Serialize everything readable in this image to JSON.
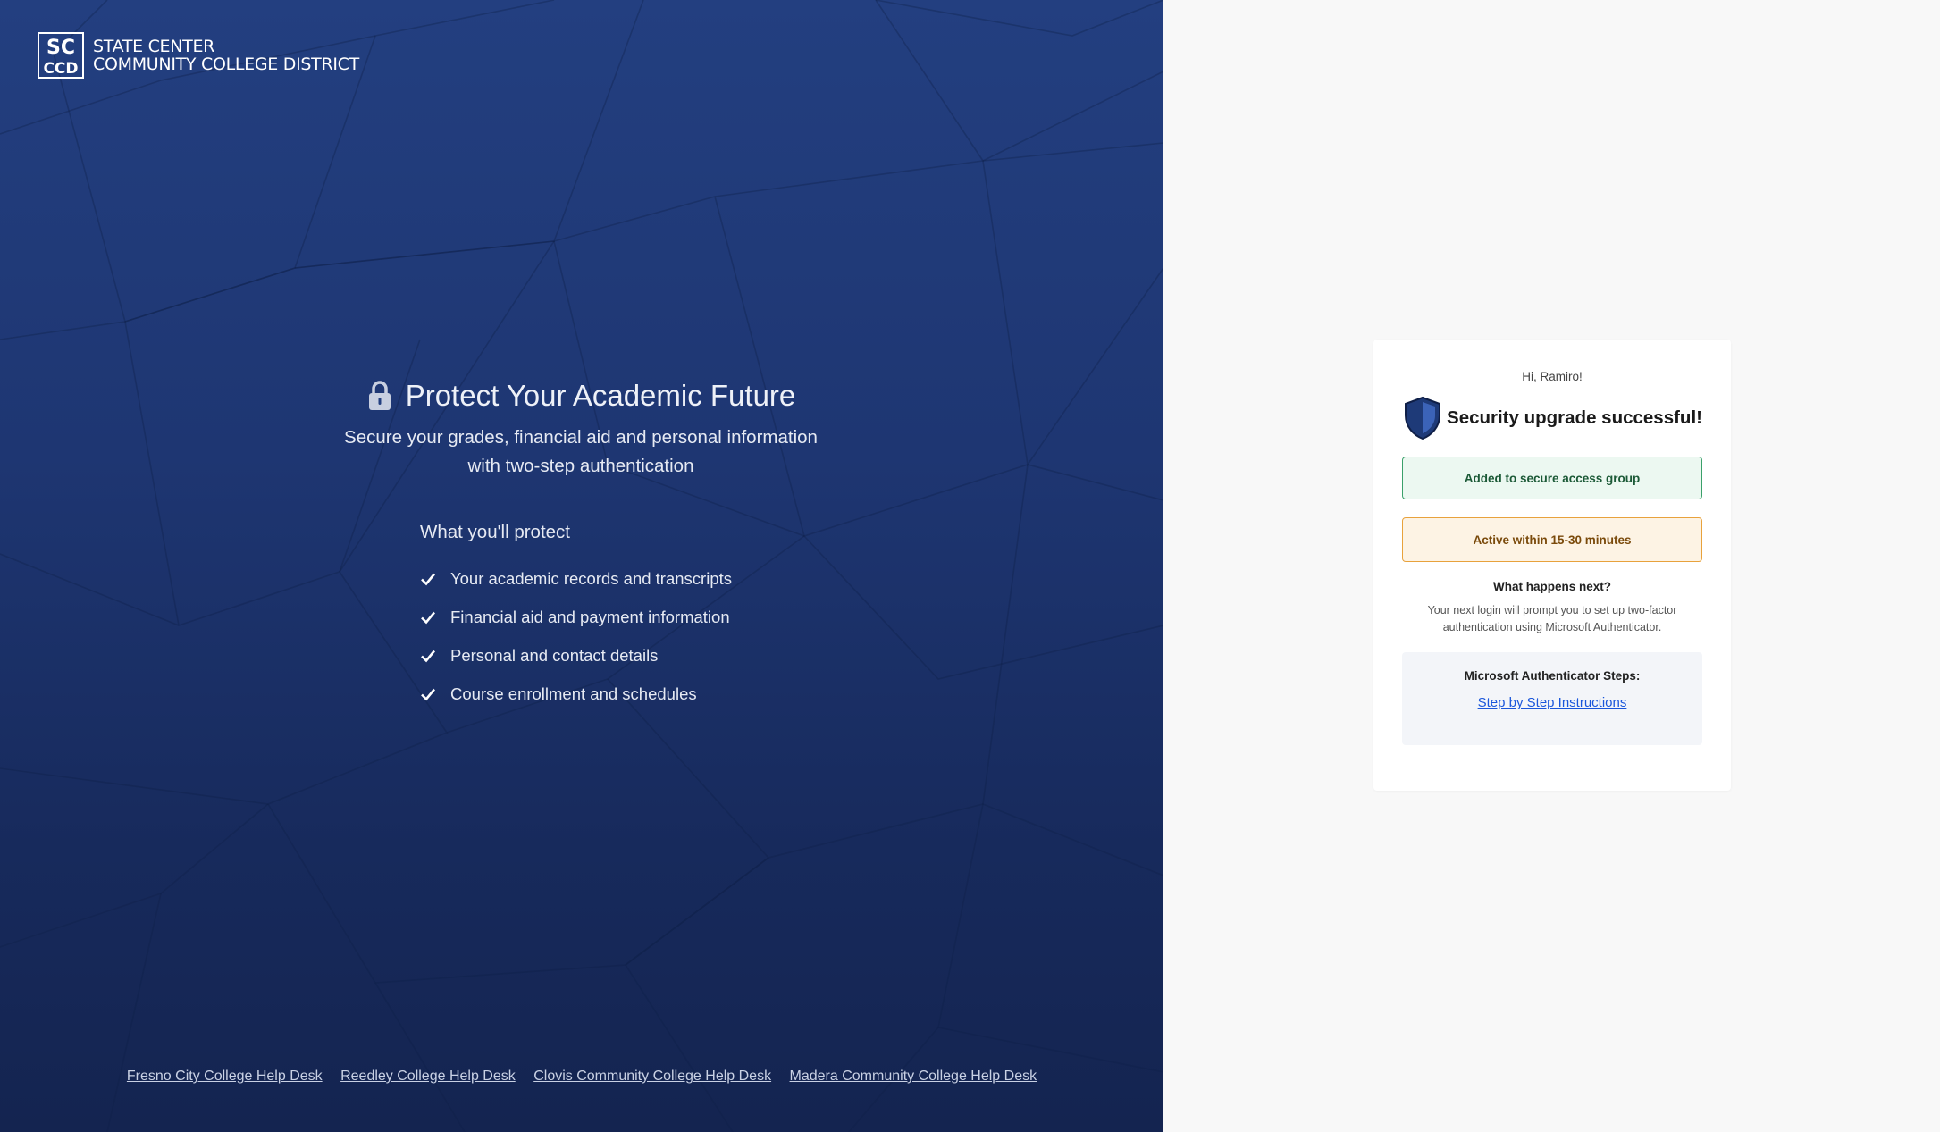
{
  "brand": {
    "logo_letters_top": "SC",
    "logo_letters_bottom": "CCD",
    "line1": "STATE CENTER",
    "line2": "COMMUNITY COLLEGE DISTRICT"
  },
  "hero": {
    "title": "Protect Your Academic Future",
    "subtitle_line1": "Secure your grades, financial aid and personal information",
    "subtitle_line2": "with two-step authentication",
    "icon": "lock-icon"
  },
  "protect": {
    "title": "What you'll protect",
    "items": [
      "Your academic records and transcripts",
      "Financial aid and payment information",
      "Personal and contact details",
      "Course enrollment and schedules"
    ]
  },
  "footer": {
    "links": [
      "Fresno City College Help Desk",
      "Reedley College Help Desk",
      "Clovis Community College Help Desk",
      "Madera Community College Help Desk"
    ]
  },
  "card": {
    "greeting": "Hi, Ramiro!",
    "title": "Security upgrade successful!",
    "status_group": "Added to secure access group",
    "status_time": "Active within 15-30 minutes",
    "next_title": "What happens next?",
    "next_text_line1": "Your next login will prompt you to set up two-factor",
    "next_text_line2": "authentication using Microsoft Authenticator.",
    "steps_title": "Microsoft Authenticator Steps:",
    "steps_link": "Step by Step Instructions"
  },
  "colors": {
    "panel_top": "#233f80",
    "panel_bottom": "#142450",
    "success_bg": "#ecf8f1",
    "success_border": "#3aa06a",
    "warning_bg": "#fdf3e4",
    "warning_border": "#e8a23c",
    "link": "#1a56db"
  }
}
